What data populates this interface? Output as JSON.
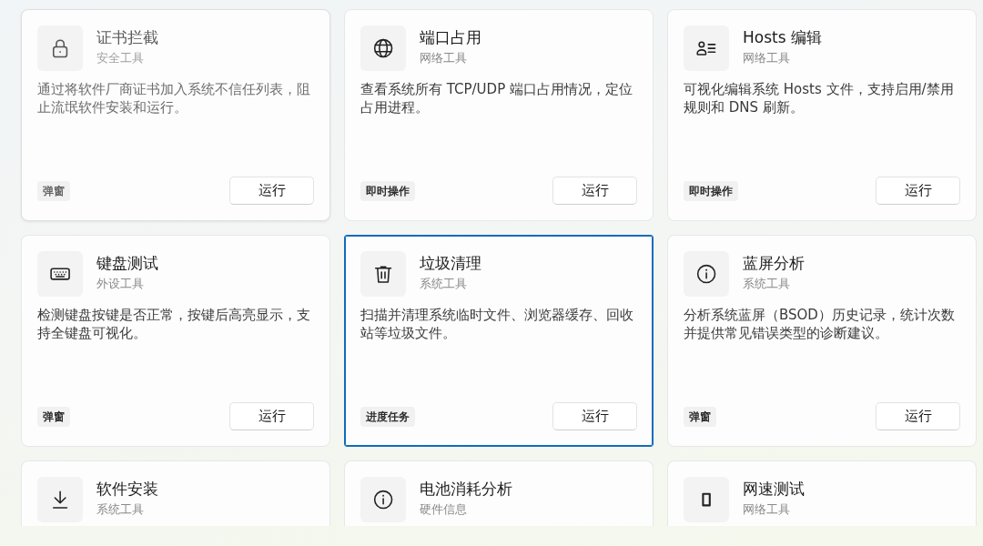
{
  "tools": [
    {
      "title": "证书拦截",
      "category": "安全工具",
      "description": "通过将软件厂商证书加入系统不信任列表，阻止流氓软件安装和运行。",
      "tag": "弹窗",
      "button": "运行",
      "selected": false,
      "disabled": true
    },
    {
      "title": "端口占用",
      "category": "网络工具",
      "description": "查看系统所有 TCP/UDP 端口占用情况，定位占用进程。",
      "tag": "即时操作",
      "button": "运行",
      "selected": false,
      "disabled": false
    },
    {
      "title": "Hosts 编辑",
      "category": "网络工具",
      "description": "可视化编辑系统 Hosts 文件，支持启用/禁用规则和 DNS 刷新。",
      "tag": "即时操作",
      "button": "运行",
      "selected": false,
      "disabled": false
    },
    {
      "title": "键盘测试",
      "category": "外设工具",
      "description": "检测键盘按键是否正常，按键后高亮显示，支持全键盘可视化。",
      "tag": "弹窗",
      "button": "运行",
      "selected": false,
      "disabled": false
    },
    {
      "title": "垃圾清理",
      "category": "系统工具",
      "description": "扫描并清理系统临时文件、浏览器缓存、回收站等垃圾文件。",
      "tag": "进度任务",
      "button": "运行",
      "selected": true,
      "disabled": false
    },
    {
      "title": "蓝屏分析",
      "category": "系统工具",
      "description": "分析系统蓝屏（BSOD）历史记录，统计次数并提供常见错误类型的诊断建议。",
      "tag": "弹窗",
      "button": "运行",
      "selected": false,
      "disabled": false
    },
    {
      "title": "软件安装",
      "category": "系统工具",
      "selected": false,
      "disabled": false
    },
    {
      "title": "电池消耗分析",
      "category": "硬件信息",
      "selected": false,
      "disabled": false
    },
    {
      "title": "网速测试",
      "category": "网络工具",
      "selected": false,
      "disabled": false
    }
  ]
}
